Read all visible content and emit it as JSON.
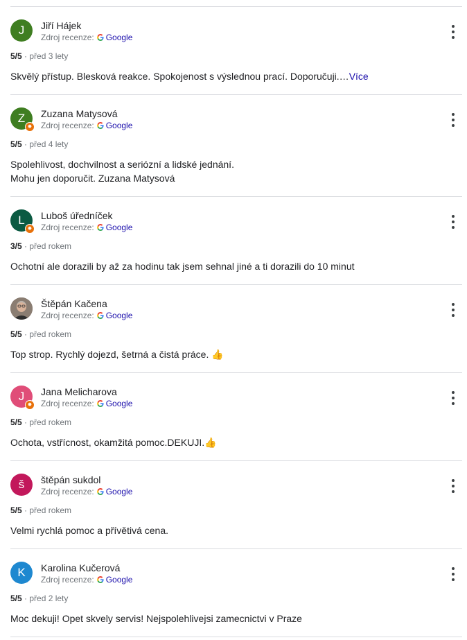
{
  "source_label": "Zdroj recenze:",
  "source_name": "Google",
  "reviews": [
    {
      "initial": "J",
      "avatar_color": "#3f7e21",
      "local_guide": false,
      "photo": false,
      "name": "Jiří Hájek",
      "rating": "5/5",
      "time": "před 3 lety",
      "text": "Skvělý přístup. Blesková reakce. Spokojenost s výslednou prací. Doporučuji.…",
      "more": "Více"
    },
    {
      "initial": "Z",
      "avatar_color": "#3f7e21",
      "local_guide": true,
      "photo": false,
      "name": "Zuzana Matysová",
      "rating": "5/5",
      "time": "před 4 lety",
      "text": "Spolehlivost, dochvilnost a seriózní a lidské jednání.",
      "text2": "Mohu jen doporučit. Zuzana Matysová"
    },
    {
      "initial": "L",
      "avatar_color": "#0b5a42",
      "local_guide": true,
      "photo": false,
      "name": "Luboš úředníček",
      "rating": "3/5",
      "time": "před rokem",
      "text": "Ochotní ale dorazili by až za hodinu tak jsem sehnal jiné a ti dorazili do 10 minut"
    },
    {
      "initial": "",
      "avatar_color": "#6f6259",
      "local_guide": false,
      "photo": true,
      "name": "Štěpán Kačena",
      "rating": "5/5",
      "time": "před rokem",
      "text": "Top strop. Rychlý dojezd, šetrná a čistá práce. 👍"
    },
    {
      "initial": "J",
      "avatar_color": "#e04d78",
      "local_guide": true,
      "photo": false,
      "name": "Jana Melicharova",
      "rating": "5/5",
      "time": "před rokem",
      "text": "Ochota, vstřícnost, okamžitá pomoc.DEKUJI.👍"
    },
    {
      "initial": "š",
      "avatar_color": "#c2185b",
      "local_guide": false,
      "photo": false,
      "name": "štěpán sukdol",
      "rating": "5/5",
      "time": "před rokem",
      "text": "Velmi rychlá pomoc a přívětivá cena."
    },
    {
      "initial": "K",
      "avatar_color": "#1e88d0",
      "local_guide": false,
      "photo": false,
      "name": "Karolina Kučerová",
      "rating": "5/5",
      "time": "před 2 lety",
      "text": "Moc dekuji! Opet skvely servis! Nejspolehlivejsi zamecnictvi v Praze"
    }
  ]
}
